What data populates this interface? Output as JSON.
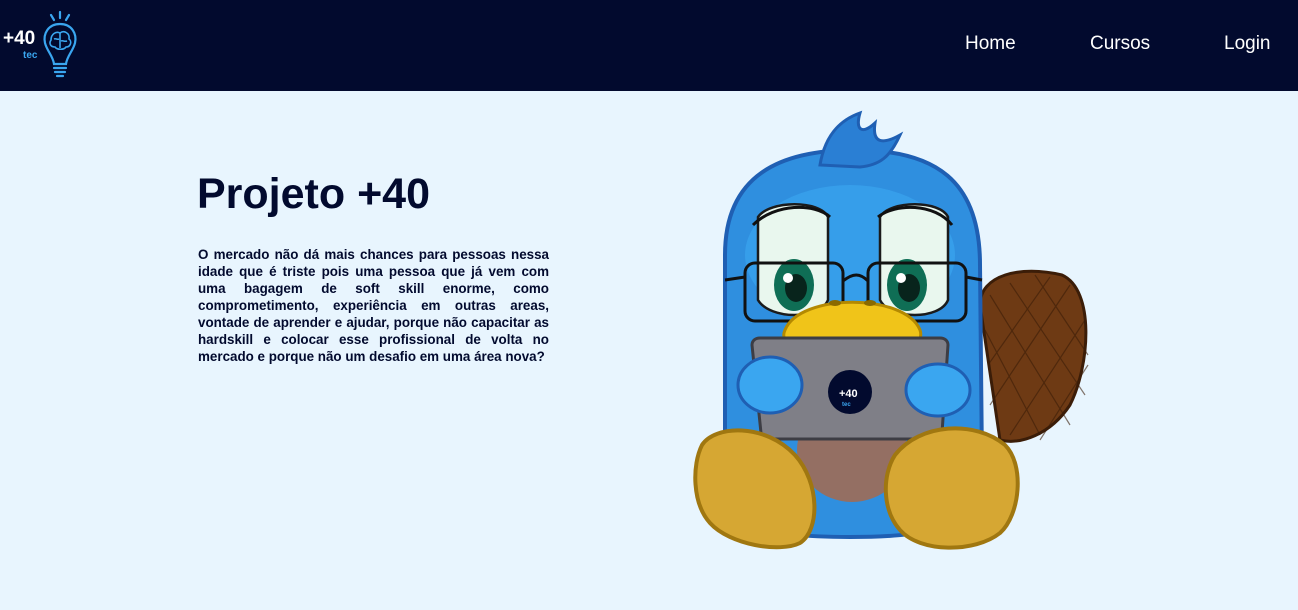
{
  "header": {
    "logo": {
      "main": "+40",
      "sub": "tec"
    },
    "nav": [
      {
        "label": "Home"
      },
      {
        "label": "Cursos"
      },
      {
        "label": "Login"
      }
    ]
  },
  "hero": {
    "title": "Projeto +40",
    "description": "O mercado não dá mais chances para pessoas nessa idade que é triste pois uma pessoa que já vem com uma bagagem de soft skill enorme, como comprometimento, experiência em outras areas, vontade de aprender e ajudar, porque não capacitar as hardskill e colocar esse profissional de volta no mercado e porque não um desafio em uma área nova?"
  },
  "colors": {
    "navbar": "#020a2e",
    "background": "#e8f5fe",
    "accent": "#3aa6f0"
  },
  "icons": [
    "lightbulb-brain-icon",
    "platypus-mascot-illustration"
  ]
}
